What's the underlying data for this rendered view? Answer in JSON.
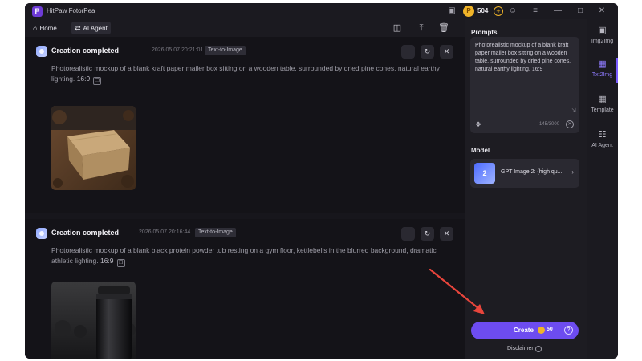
{
  "app": {
    "title": "HitPaw FotorPea",
    "logo_letter": "P",
    "credits": "504"
  },
  "toolbar": {
    "home_label": "Home",
    "agent_label": "AI Agent"
  },
  "feed": [
    {
      "title": "Creation completed",
      "time": "2026.05.07  20:21:01",
      "tag": "Text-to-Image",
      "prompt": "Photorealistic mockup of a blank kraft paper mailer box sitting on a wooden table, surrounded by dried pine cones, natural earthy lighting.",
      "ratio": "16:9"
    },
    {
      "title": "Creation completed",
      "time": "2026.05.07  20:16:44",
      "tag": "Text-to-Image",
      "prompt": "Photorealistic mockup of a blank black protein powder tub resting on a gym floor, kettlebells in the blurred background, dramatic athletic lighting.",
      "ratio": "16:9"
    }
  ],
  "panel": {
    "prompts_label": "Prompts",
    "prompt_text": "Photorealistic mockup of a blank kraft paper mailer box sitting on a wooden table, surrounded by dried pine cones, natural earthy lighting. 16:9",
    "char_count": "145/3000",
    "model_label": "Model",
    "model_badge": "2",
    "model_name": "GPT Image 2: (high qu...",
    "create_label": "Create",
    "create_cost": "50",
    "disclaimer": "Disclaimer"
  },
  "sidenav": [
    {
      "label": "Img2Img"
    },
    {
      "label": "Txt2Img"
    },
    {
      "label": "Template"
    },
    {
      "label": "AI Agent"
    }
  ],
  "colors": {
    "accent": "#6d4cf0",
    "coin": "#f0b429",
    "annotation_arrow": "#e8453c"
  }
}
